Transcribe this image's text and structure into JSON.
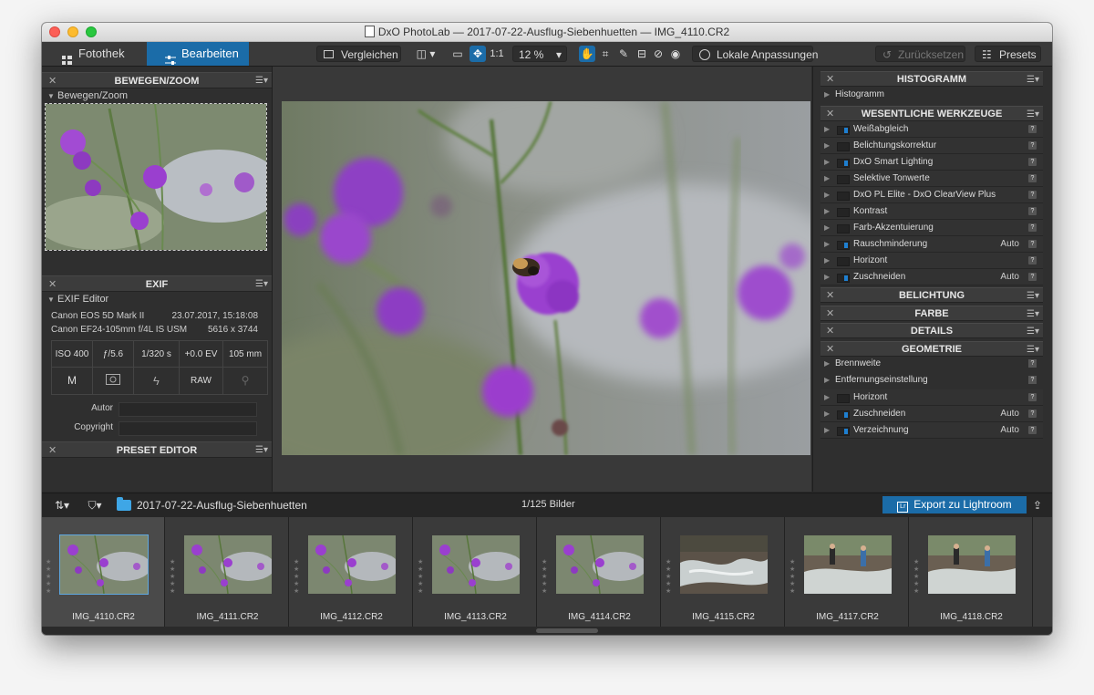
{
  "window": {
    "title": "DxO PhotoLab — 2017-07-22-Ausflug-Siebenhuetten — IMG_4110.CR2"
  },
  "toolbar": {
    "tab_library": "Fotothek",
    "tab_edit": "Bearbeiten",
    "compare": "Vergleichen",
    "one_to_one": "1:1",
    "zoom": "12 %",
    "local_adjust": "Lokale Anpassungen",
    "reset": "Zurücksetzen",
    "presets": "Presets"
  },
  "left": {
    "move_zoom_header": "BEWEGEN/ZOOM",
    "move_zoom_sub": "Bewegen/Zoom",
    "exif_header": "EXIF",
    "exif_sub": "EXIF Editor",
    "camera": "Canon EOS 5D Mark II",
    "date": "23.07.2017, 15:18:08",
    "lens": "Canon EF24-105mm f/4L IS USM",
    "dims": "5616 x 3744",
    "iso": "ISO 400",
    "aperture": "ƒ/5.6",
    "shutter": "1/320 s",
    "ev": "+0.0 EV",
    "focal": "105 mm",
    "mode": "M",
    "raw": "RAW",
    "author_label": "Autor",
    "copyright_label": "Copyright",
    "preset_header": "PRESET EDITOR"
  },
  "right": {
    "histogram_header": "HISTOGRAMM",
    "histogram_sub": "Histogramm",
    "essentials_header": "WESENTLICHE WERKZEUGE",
    "essentials": [
      {
        "label": "Weißabgleich",
        "on": true,
        "auto": ""
      },
      {
        "label": "Belichtungskorrektur",
        "on": false,
        "auto": ""
      },
      {
        "label": "DxO Smart Lighting",
        "on": true,
        "auto": ""
      },
      {
        "label": "Selektive Tonwerte",
        "on": false,
        "auto": ""
      },
      {
        "label": "DxO PL Elite - DxO ClearView Plus",
        "on": false,
        "auto": ""
      },
      {
        "label": "Kontrast",
        "on": false,
        "auto": ""
      },
      {
        "label": "Farb-Akzentuierung",
        "on": false,
        "auto": ""
      },
      {
        "label": "Rauschminderung",
        "on": true,
        "auto": "Auto"
      },
      {
        "label": "Horizont",
        "on": false,
        "auto": ""
      },
      {
        "label": "Zuschneiden",
        "on": true,
        "auto": "Auto"
      }
    ],
    "exposure_header": "BELICHTUNG",
    "color_header": "FARBE",
    "details_header": "DETAILS",
    "geometry_header": "GEOMETRIE",
    "geometry_plain": [
      "Brennweite",
      "Entfernungseinstellung"
    ],
    "geometry": [
      {
        "label": "Horizont",
        "on": false,
        "auto": ""
      },
      {
        "label": "Zuschneiden",
        "on": true,
        "auto": "Auto"
      },
      {
        "label": "Verzeichnung",
        "on": true,
        "auto": "Auto"
      }
    ],
    "help": "?"
  },
  "filmbar": {
    "folder": "2017-07-22-Ausflug-Siebenhuetten",
    "count": "1/125 Bilder",
    "export": "Export zu Lightroom",
    "lr_badge": "Lr"
  },
  "filmstrip": [
    {
      "name": "IMG_4110.CR2",
      "kind": "flower",
      "selected": true
    },
    {
      "name": "IMG_4111.CR2",
      "kind": "flower",
      "selected": false
    },
    {
      "name": "IMG_4112.CR2",
      "kind": "flower",
      "selected": false
    },
    {
      "name": "IMG_4113.CR2",
      "kind": "flower",
      "selected": false
    },
    {
      "name": "IMG_4114.CR2",
      "kind": "flower",
      "selected": false
    },
    {
      "name": "IMG_4115.CR2",
      "kind": "stream",
      "selected": false
    },
    {
      "name": "IMG_4117.CR2",
      "kind": "people",
      "selected": false
    },
    {
      "name": "IMG_4118.CR2",
      "kind": "people",
      "selected": false
    }
  ],
  "colors": {
    "accent": "#1b6ca8",
    "panel": "#2f2f2f",
    "flower": "#9a3fcf"
  }
}
